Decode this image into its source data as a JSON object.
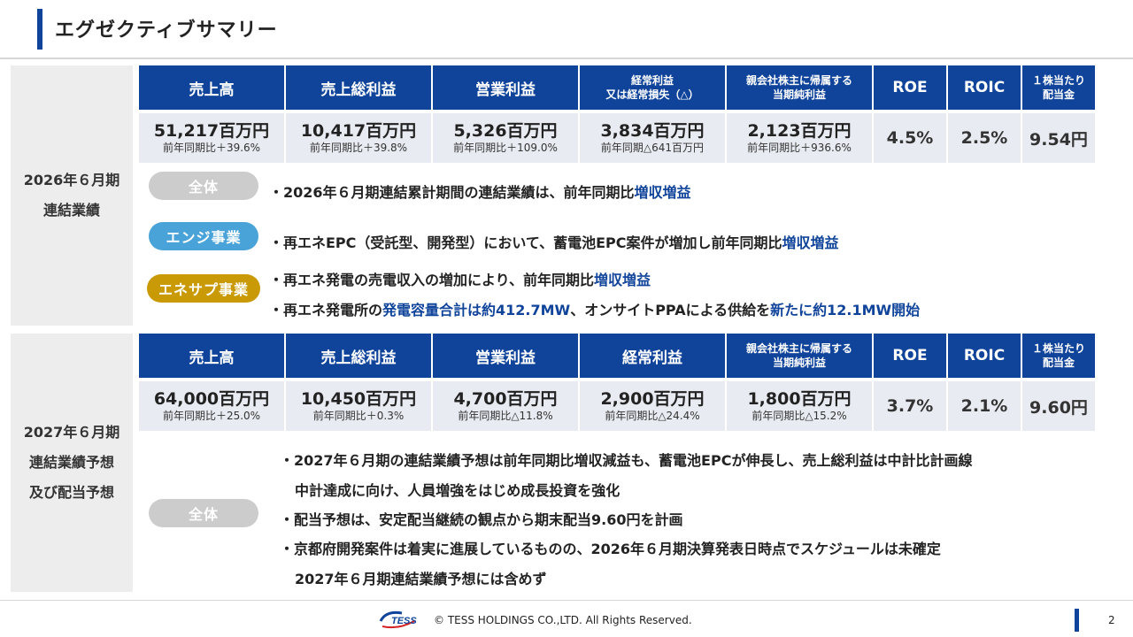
{
  "title": "エグゼクティブサマリー",
  "section1": {
    "label_line1": "2026年６月期",
    "label_line2": "連結業績",
    "headers": [
      {
        "lines": [
          "売上高"
        ],
        "size": "big"
      },
      {
        "lines": [
          "売上総利益"
        ],
        "size": "big"
      },
      {
        "lines": [
          "営業利益"
        ],
        "size": "big"
      },
      {
        "lines": [
          "経常利益",
          "又は経常損失（△）"
        ],
        "size": "small"
      },
      {
        "lines": [
          "親会社株主に帰属する",
          "当期純利益"
        ],
        "size": "small"
      },
      {
        "lines": [
          "ROE"
        ],
        "size": "big"
      },
      {
        "lines": [
          "ROIC"
        ],
        "size": "big"
      },
      {
        "lines": [
          "１株当たり",
          "配当金"
        ],
        "size": "small"
      }
    ],
    "values": [
      {
        "v": "51,217百万円",
        "s": "前年同期比＋39.6%"
      },
      {
        "v": "10,417百万円",
        "s": "前年同期比＋39.8%"
      },
      {
        "v": "5,326百万円",
        "s": "前年同期比＋109.0%"
      },
      {
        "v": "3,834百万円",
        "s": "前年同期△641百万円"
      },
      {
        "v": "2,123百万円",
        "s": "前年同期比＋936.6%"
      },
      {
        "v": "4.5%",
        "s": ""
      },
      {
        "v": "2.5%",
        "s": ""
      },
      {
        "v": "9.54円",
        "s": ""
      }
    ],
    "pills": {
      "all": "全体",
      "engi": "エンジ事業",
      "enesup": "エネサプ事業"
    },
    "bullets": {
      "all": {
        "pre": "・2026年６月期連結累計期間の連結業績は、前年同期比",
        "hl": "増収増益",
        "post": ""
      },
      "engi": {
        "pre": "・再エネEPC（受託型、開発型）において、蓄電池EPC案件が増加し前年同期比",
        "hl": "増収増益",
        "post": ""
      },
      "enesup1": {
        "pre": "・再エネ発電の売電収入の増加により、前年同期比",
        "hl": "増収増益",
        "post": ""
      },
      "enesup2": {
        "pre": "・再エネ発電所の",
        "hl": "発電容量合計は約412.7MW",
        "mid": "、オンサイトPPAによる供給を",
        "hl2": "新たに約12.1MW開始"
      }
    }
  },
  "section2": {
    "label_line1": "2027年６月期",
    "label_line2": "連結業績予想",
    "label_line3": "及び配当予想",
    "headers": [
      {
        "lines": [
          "売上高"
        ],
        "size": "big"
      },
      {
        "lines": [
          "売上総利益"
        ],
        "size": "big"
      },
      {
        "lines": [
          "営業利益"
        ],
        "size": "big"
      },
      {
        "lines": [
          "経常利益"
        ],
        "size": "big"
      },
      {
        "lines": [
          "親会社株主に帰属する",
          "当期純利益"
        ],
        "size": "small"
      },
      {
        "lines": [
          "ROE"
        ],
        "size": "big"
      },
      {
        "lines": [
          "ROIC"
        ],
        "size": "big"
      },
      {
        "lines": [
          "１株当たり",
          "配当金"
        ],
        "size": "small"
      }
    ],
    "values": [
      {
        "v": "64,000百万円",
        "s": "前年同期比＋25.0%"
      },
      {
        "v": "10,450百万円",
        "s": "前年同期比＋0.3%"
      },
      {
        "v": "4,700百万円",
        "s": "前年同期比△11.8%"
      },
      {
        "v": "2,900百万円",
        "s": "前年同期比△24.4%"
      },
      {
        "v": "1,800百万円",
        "s": "前年同期比△15.2%"
      },
      {
        "v": "3.7%",
        "s": ""
      },
      {
        "v": "2.1%",
        "s": ""
      },
      {
        "v": "9.60円",
        "s": ""
      }
    ],
    "pill": "全体",
    "bullets": [
      "・2027年６月期の連結業績予想は前年同期比増収減益も、蓄電池EPCが伸長し、売上総利益は中計比計画線",
      "中計達成に向け、人員増強をはじめ成長投資を強化",
      "・配当予想は、安定配当継続の観点から期末配当9.60円を計画",
      "・京都府開発案件は着実に進展しているものの、2026年６月期決算発表日時点でスケジュールは未確定",
      "2027年６月期連結業績予想には含めず"
    ]
  },
  "footer": {
    "logo_text": "TESS",
    "copyright": "© TESS HOLDINGS CO.,LTD. All Rights Reserved.",
    "page": "2"
  },
  "colors": {
    "primary": "#10449a",
    "cell_bg": "#e8ebf1",
    "pill_blue": "#4aa3d8",
    "pill_gold": "#c99a06",
    "pill_gray": "#cccccc"
  }
}
